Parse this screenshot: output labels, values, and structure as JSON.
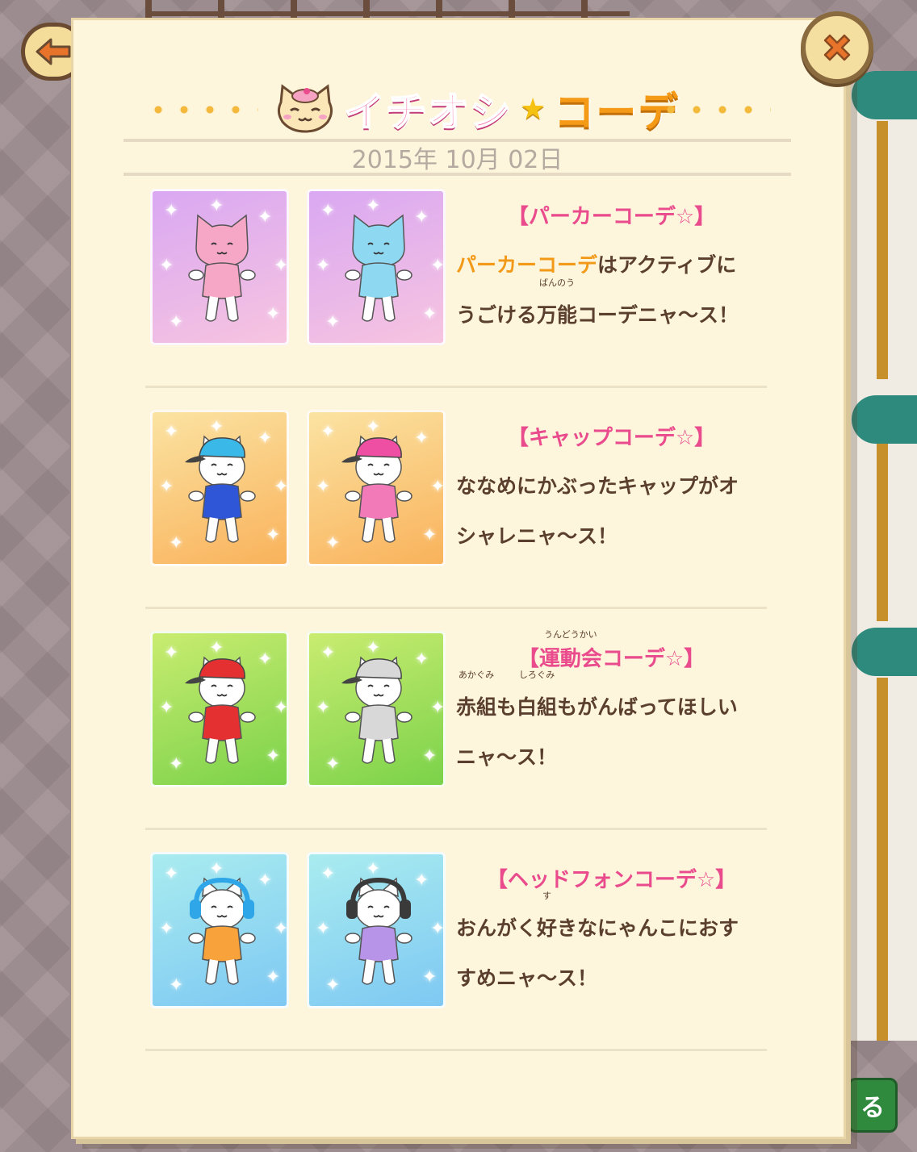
{
  "nav": {
    "back_icon": "back-arrow-icon",
    "close_icon": "close-x-icon",
    "bottom_button_label": "る"
  },
  "header": {
    "title_part1": "イチオシ",
    "title_star": "★",
    "title_part2": "コーデ",
    "date": "2015年 10月 02日"
  },
  "entries": [
    {
      "title": "【パーカーコーデ☆】",
      "highlight": "パーカーコーデ",
      "desc_rest_line1": "はアクティブに",
      "desc_line2_pre": "うごける",
      "ruby_base": "万能",
      "ruby_text": "ばんのう",
      "desc_line2_post": "コーデニャ〜ス！",
      "bg": [
        "#d9a8f2",
        "#f7c4e0"
      ],
      "items": [
        {
          "name": "pink-hoodie-cat",
          "hat": "hood",
          "color": "#f7a7c6",
          "hat_color": "#f7a7c6"
        },
        {
          "name": "blue-hoodie-cat",
          "hat": "hood",
          "color": "#8fd8f2",
          "hat_color": "#8fd8f2"
        }
      ]
    },
    {
      "title": "【キャップコーデ☆】",
      "desc_line1": "ななめにかぶったキャップがオ",
      "desc_line2": "シャレニャ〜ス！",
      "bg": [
        "#fbe3a2",
        "#f9b25b"
      ],
      "items": [
        {
          "name": "blue-cap-cat",
          "hat": "cap",
          "color": "#2e56d6",
          "hat_color": "#3ab8e8"
        },
        {
          "name": "pink-cap-cat",
          "hat": "cap",
          "color": "#f27ab8",
          "hat_color": "#ee4fa3"
        }
      ]
    },
    {
      "title_ruby_base": "運動会",
      "title_ruby_text": "うんどうかい",
      "title_pre": "【",
      "title_post": "コーデ☆】",
      "ruby1_base": "赤組",
      "ruby1_text": "あかぐみ",
      "mid1": "も",
      "ruby2_base": "白組",
      "ruby2_text": "しろぐみ",
      "desc_line1_post": "もがんばってほしい",
      "desc_line2": "ニャ〜ス！",
      "bg": [
        "#c9ec70",
        "#7bd24a"
      ],
      "items": [
        {
          "name": "red-cap-cat",
          "hat": "cap",
          "color": "#e43030",
          "hat_color": "#e43030"
        },
        {
          "name": "white-cap-cat",
          "hat": "cap",
          "color": "#d8d8d8",
          "hat_color": "#d8d8d8"
        }
      ]
    },
    {
      "title": "【ヘッドフォンコーデ☆】",
      "desc_line1_pre": "おんがく",
      "ruby_base": "好",
      "ruby_text": "す",
      "desc_line1_post": "きなにゃんこにおす",
      "desc_line2": "すめニャ〜ス！",
      "bg": [
        "#a9ecef",
        "#7ec8f3"
      ],
      "items": [
        {
          "name": "blue-headphone-cat",
          "hat": "phones",
          "color": "#f7a23a",
          "hat_color": "#2fa6e8"
        },
        {
          "name": "black-headphone-cat",
          "hat": "phones",
          "color": "#b794e8",
          "hat_color": "#3a3a3a"
        }
      ]
    }
  ]
}
